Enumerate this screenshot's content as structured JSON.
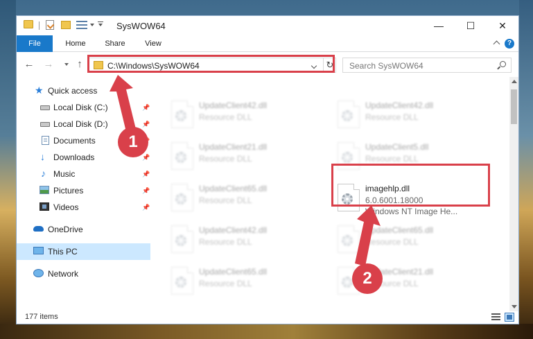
{
  "window": {
    "title": "SysWOW64",
    "controls": {
      "minimize": "—",
      "maximize": "☐",
      "close": "✕"
    }
  },
  "ribbon": {
    "tabs": [
      "File",
      "Home",
      "Share",
      "View"
    ],
    "help": "?"
  },
  "navigation": {
    "back": "←",
    "forward": "→",
    "up": "↑",
    "refresh": "↻",
    "address": "C:\\Windows\\SysWOW64",
    "search_placeholder": "Search SysWOW64"
  },
  "sidebar": {
    "items": [
      {
        "label": "Quick access",
        "icon": "star-icon"
      },
      {
        "label": "Local Disk (C:)",
        "icon": "disk-icon",
        "pinned": true
      },
      {
        "label": "Local Disk (D:)",
        "icon": "disk-icon",
        "pinned": true
      },
      {
        "label": "Documents",
        "icon": "documents-icon",
        "pinned": true
      },
      {
        "label": "Downloads",
        "icon": "download-icon",
        "pinned": true
      },
      {
        "label": "Music",
        "icon": "music-icon",
        "pinned": true
      },
      {
        "label": "Pictures",
        "icon": "pictures-icon",
        "pinned": true
      },
      {
        "label": "Videos",
        "icon": "videos-icon",
        "pinned": true
      },
      {
        "label": "OneDrive",
        "icon": "onedrive-icon"
      },
      {
        "label": "This PC",
        "icon": "pc-icon",
        "selected": true
      },
      {
        "label": "Network",
        "icon": "network-icon"
      }
    ]
  },
  "files": {
    "rows": [
      [
        {
          "name": "UpdateClient42.dll",
          "type": "Resource DLL",
          "blurred": true
        },
        {
          "name": "UpdateClient42.dll",
          "type": "Resource DLL",
          "blurred": true
        }
      ],
      [
        {
          "name": "UpdateClient21.dll",
          "type": "Resource DLL",
          "blurred": true
        },
        {
          "name": "UpdateClient5.dll",
          "type": "Resource DLL",
          "blurred": true
        }
      ],
      [
        {
          "name": "UpdateClient65.dll",
          "type": "Resource DLL",
          "blurred": true
        },
        {
          "name": "imagehlp.dll",
          "version": "6.0.6001.18000",
          "description": "Windows NT Image He...",
          "blurred": false
        }
      ],
      [
        {
          "name": "UpdateClient42.dll",
          "type": "Resource DLL",
          "blurred": true
        },
        {
          "name": "UpdateClient65.dll",
          "type": "Resource DLL",
          "blurred": true
        }
      ],
      [
        {
          "name": "UpdateClient65.dll",
          "type": "Resource DLL",
          "blurred": true
        },
        {
          "name": "UpdateClient21.dll",
          "type": "Resource DLL",
          "blurred": true
        }
      ]
    ]
  },
  "status": {
    "item_count": "177 items"
  },
  "callouts": [
    "1",
    "2"
  ],
  "colors": {
    "accent": "#1979ca",
    "highlight": "#d9404a",
    "selection": "#cce8ff"
  }
}
